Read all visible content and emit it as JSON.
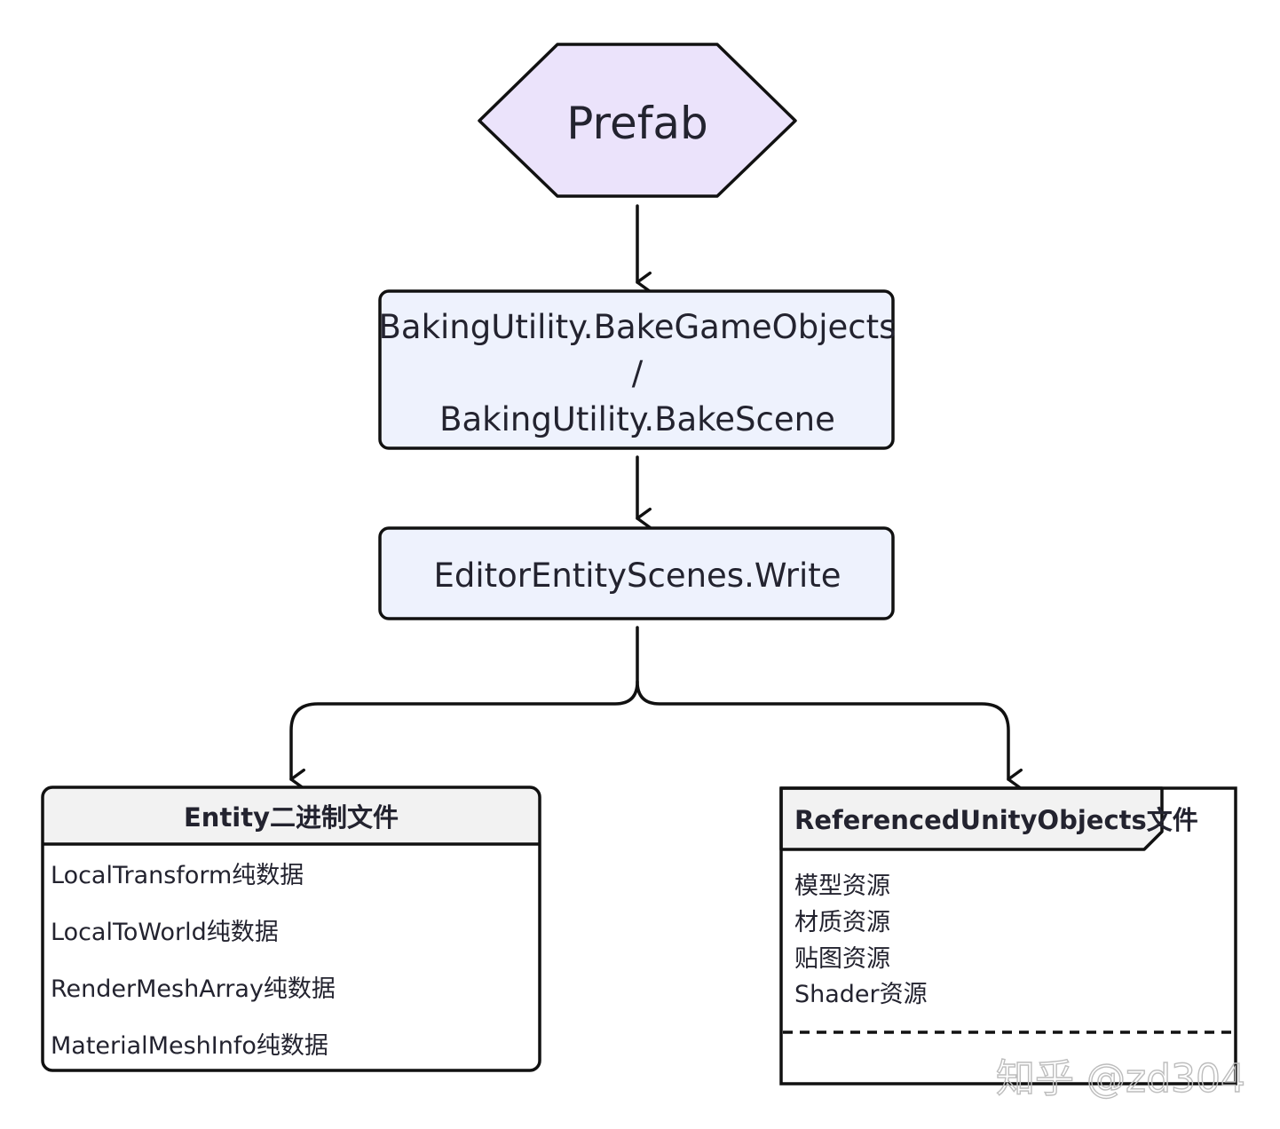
{
  "nodes": {
    "prefab": {
      "label": "Prefab",
      "fill": "#ebe3fb"
    },
    "bake": {
      "lines": [
        "BakingUtility.BakeGameObjects",
        "/",
        "BakingUtility.BakeScene"
      ],
      "fill": "#eef2fd"
    },
    "write": {
      "label": "EditorEntityScenes.Write",
      "fill": "#eef2fd"
    },
    "entity_file": {
      "header": "Entity二进制文件",
      "header_fill": "#f2f2f2",
      "items": [
        "LocalTransform纯数据",
        "LocalToWorld纯数据",
        "RenderMeshArray纯数据",
        "MaterialMeshInfo纯数据"
      ]
    },
    "ref_objects": {
      "header": "ReferencedUnityObjects文件",
      "header_fill": "#f2f2f2",
      "items": [
        "模型资源",
        "材质资源",
        "贴图资源",
        "Shader资源"
      ]
    }
  },
  "watermark": "知乎 @zd304",
  "colors": {
    "stroke": "#111111",
    "text": "#23232f"
  }
}
